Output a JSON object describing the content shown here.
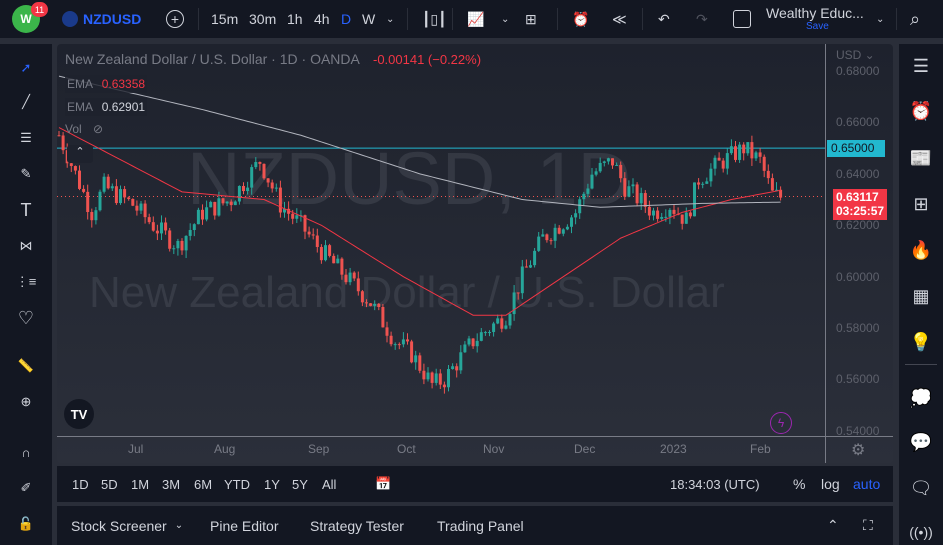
{
  "topbar": {
    "notifications": "11",
    "symbol": "NZDUSD",
    "intervals": [
      "15m",
      "30m",
      "1h",
      "4h",
      "D",
      "W"
    ],
    "active_interval": "D",
    "layout_name": "Wealthy Educ...",
    "save_label": "Save"
  },
  "legend": {
    "title": "New Zealand Dollar / U.S. Dollar · 1D · OANDA",
    "change": "-0.00141 (−0.22%)",
    "ema1_label": "EMA",
    "ema1_value": "0.63358",
    "ema2_label": "EMA",
    "ema2_value": "0.62901",
    "vol_label": "Vol"
  },
  "watermark": {
    "symbol": "NZDUSD, 1D",
    "name": "New Zealand Dollar / U.S. Dollar"
  },
  "price_axis": {
    "currency": "USD",
    "labels": [
      "0.68000",
      "0.66000",
      "0.64000",
      "0.62000",
      "0.60000",
      "0.58000",
      "0.56000",
      "0.54000"
    ],
    "line_label": "0.65000",
    "last_price": "0.63117",
    "countdown": "03:25:57"
  },
  "time_axis": {
    "labels": [
      "Jul",
      "Aug",
      "Sep",
      "Oct",
      "Nov",
      "Dec",
      "2023",
      "Feb"
    ]
  },
  "ranges": [
    "1D",
    "5D",
    "1M",
    "3M",
    "6M",
    "YTD",
    "1Y",
    "5Y",
    "All"
  ],
  "status": {
    "clock": "18:34:03 (UTC)",
    "percent": "%",
    "log": "log",
    "auto": "auto"
  },
  "footer": {
    "tabs": [
      "Stock Screener",
      "Pine Editor",
      "Strategy Tester",
      "Trading Panel"
    ]
  },
  "colors": {
    "up": "#26a69a",
    "down": "#ef5350",
    "accent": "#2962ff",
    "hline": "#22b8cf",
    "ema_fast": "#f23645",
    "ema_slow": "#b2b5be"
  },
  "chart_data": {
    "type": "candlestick",
    "ylim": [
      0.54,
      0.68
    ],
    "bars": 176,
    "close_path": [
      [
        0,
        0.655
      ],
      [
        4,
        0.64
      ],
      [
        8,
        0.625
      ],
      [
        11,
        0.635
      ],
      [
        18,
        0.628
      ],
      [
        23,
        0.62
      ],
      [
        29,
        0.612
      ],
      [
        35,
        0.625
      ],
      [
        42,
        0.63
      ],
      [
        49,
        0.645
      ],
      [
        54,
        0.628
      ],
      [
        59,
        0.62
      ],
      [
        64,
        0.61
      ],
      [
        70,
        0.6
      ],
      [
        76,
        0.59
      ],
      [
        82,
        0.575
      ],
      [
        86,
        0.57
      ],
      [
        91,
        0.558
      ],
      [
        94,
        0.56
      ],
      [
        101,
        0.575
      ],
      [
        105,
        0.58
      ],
      [
        109,
        0.585
      ],
      [
        113,
        0.6
      ],
      [
        118,
        0.615
      ],
      [
        122,
        0.62
      ],
      [
        126,
        0.625
      ],
      [
        130,
        0.64
      ],
      [
        135,
        0.645
      ],
      [
        138,
        0.635
      ],
      [
        145,
        0.625
      ],
      [
        149,
        0.628
      ],
      [
        153,
        0.622
      ],
      [
        156,
        0.638
      ],
      [
        162,
        0.645
      ],
      [
        167,
        0.65
      ],
      [
        171,
        0.645
      ],
      [
        174,
        0.632
      ],
      [
        176,
        0.631
      ]
    ],
    "ema_fast": [
      [
        0,
        0.658
      ],
      [
        30,
        0.633
      ],
      [
        50,
        0.63
      ],
      [
        64,
        0.62
      ],
      [
        84,
        0.6
      ],
      [
        101,
        0.585
      ],
      [
        109,
        0.585
      ],
      [
        123,
        0.6
      ],
      [
        137,
        0.615
      ],
      [
        152,
        0.625
      ],
      [
        164,
        0.63
      ],
      [
        176,
        0.6336
      ]
    ],
    "ema_slow": [
      [
        0,
        0.678
      ],
      [
        35,
        0.665
      ],
      [
        59,
        0.655
      ],
      [
        88,
        0.64
      ],
      [
        113,
        0.63
      ],
      [
        132,
        0.627
      ],
      [
        157,
        0.6285
      ],
      [
        176,
        0.629
      ]
    ],
    "hline": 0.65
  }
}
